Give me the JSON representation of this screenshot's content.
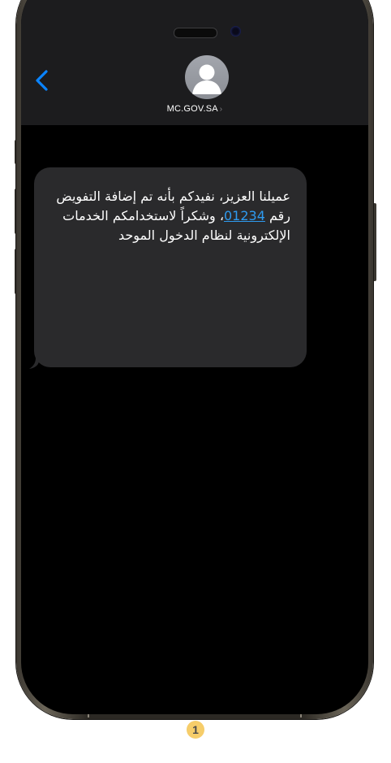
{
  "header": {
    "contact_name": "MC.GOV.SA",
    "contact_chevron": "›",
    "back_icon": "chevron-left-icon",
    "avatar_icon": "person-icon"
  },
  "message": {
    "text_before_code": "عميلنا العزيز، نفيدكم بأنه تم إضافة التفويض رقم ",
    "code": "01234",
    "text_after_code": "، وشكراً لاستخدامكم الخدمات الإلكترونية لنظام الدخول الموحد"
  },
  "step": {
    "number": "1"
  },
  "colors": {
    "screen_background": "#000000",
    "header_background": "#1c1c1e",
    "bubble_background": "#2a2a2c",
    "link_color": "#2e9bf0",
    "back_icon_color": "#0a84ff",
    "step_badge": "#f6cd6a"
  }
}
